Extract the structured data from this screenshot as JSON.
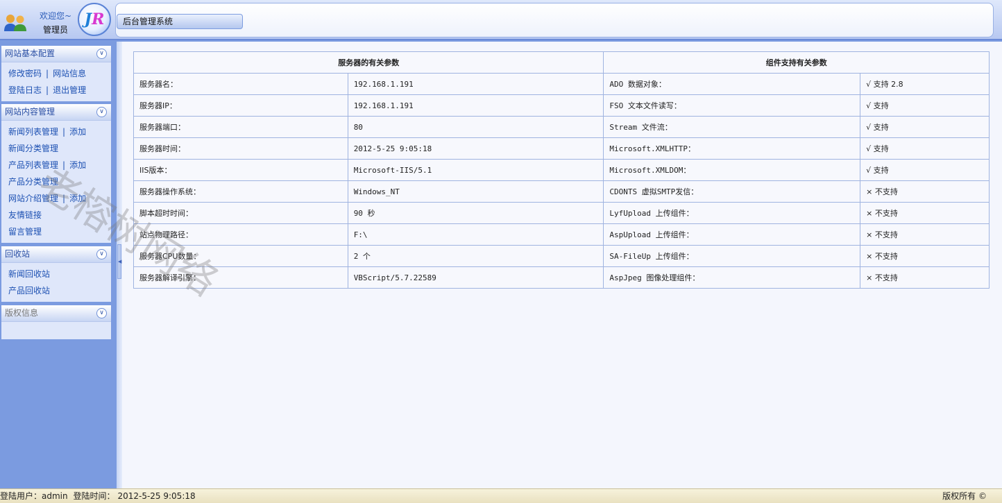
{
  "header": {
    "welcome_line1": "欢迎您~",
    "welcome_line2": "管理员",
    "logo_j": "J",
    "logo_r": "R",
    "system_title": "后台管理系统"
  },
  "sidebar": {
    "groups": [
      {
        "title": "网站基本配置",
        "rows": [
          [
            "修改密码",
            "网站信息"
          ],
          [
            "登陆日志",
            "退出管理"
          ]
        ]
      },
      {
        "title": "网站内容管理",
        "rows": [
          [
            "新闻列表管理",
            "添加"
          ],
          [
            "新闻分类管理"
          ],
          [
            "产品列表管理",
            "添加"
          ],
          [
            "产品分类管理"
          ],
          [
            "网站介绍管理",
            "添加"
          ],
          [
            "友情链接"
          ],
          [
            "留言管理"
          ]
        ]
      },
      {
        "title": "回收站",
        "rows": [
          [
            "新闻回收站"
          ],
          [
            "产品回收站"
          ]
        ]
      },
      {
        "title": "版权信息",
        "rows": []
      }
    ]
  },
  "table": {
    "head_server": "服务器的有关参数",
    "head_component": "组件支持有关参数",
    "rows": [
      [
        "服务器名：",
        "192.168.1.191",
        "ADO 数据对象：",
        "√ 支持 2.8"
      ],
      [
        "服务器IP：",
        "192.168.1.191",
        "FSO 文本文件读写：",
        "√ 支持"
      ],
      [
        "服务器端口：",
        "80",
        "Stream 文件流：",
        "√ 支持"
      ],
      [
        "服务器时间：",
        "2012-5-25 9:05:18",
        "Microsoft.XMLHTTP：",
        "√ 支持"
      ],
      [
        "IIS版本：",
        "Microsoft-IIS/5.1",
        "Microsoft.XMLDOM：",
        "√ 支持"
      ],
      [
        "服务器操作系统：",
        "Windows_NT",
        "CDONTS 虚拟SMTP发信：",
        "× 不支持"
      ],
      [
        "脚本超时时间：",
        "90 秒",
        "LyfUpload 上传组件：",
        "× 不支持"
      ],
      [
        "站点物理路径：",
        "F:\\",
        "AspUpload 上传组件：",
        "× 不支持"
      ],
      [
        "服务器CPU数量：",
        "2 个",
        "SA-FileUp 上传组件：",
        "× 不支持"
      ],
      [
        "服务器解译引擎：",
        "VBScript/5.7.22589",
        "AspJpeg 图像处理组件：",
        "× 不支持"
      ]
    ]
  },
  "watermark": "老榕树网络",
  "status": {
    "user_label": "登陆用户：admin",
    "time_label": "登陆时间：",
    "time_value": "2012-5-25 9:05:18",
    "copyright": "版权所有 ©"
  }
}
